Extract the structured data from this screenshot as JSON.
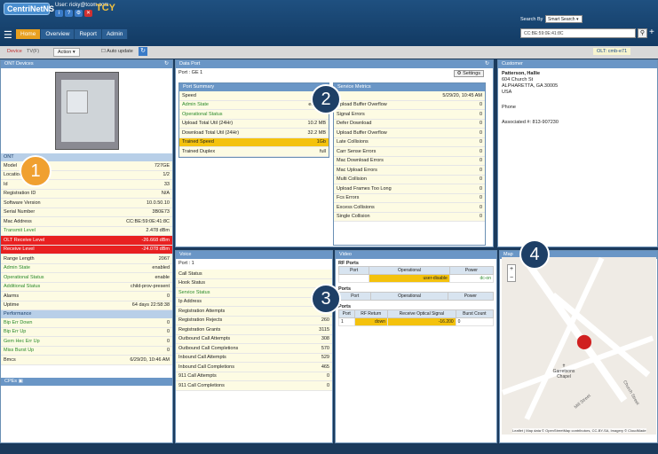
{
  "header": {
    "logo": "CentriNetNS",
    "user": "User: ricky@tcom.com",
    "brand_y": "TCY",
    "nav": [
      "Home",
      "Overview",
      "Report",
      "Admin"
    ],
    "search_label": "Search By",
    "search_mode": "Smart Search",
    "search_value": "CC:BE:59:0E:41:8C"
  },
  "subbar": {
    "device": "Device",
    "tbd": "TV(F)",
    "action": "Action",
    "auto_update": "Auto update",
    "olt": "OLT: cmb-e71"
  },
  "ont": {
    "title": "ONT Devices",
    "section": "ONT",
    "rows": [
      {
        "k": "Model",
        "v": "727GE",
        "g": false
      },
      {
        "k": "Location",
        "v": "1/2",
        "g": false
      },
      {
        "k": "Id",
        "v": "33",
        "g": false
      },
      {
        "k": "Registration ID",
        "v": "N/A",
        "g": false
      },
      {
        "k": "Software Version",
        "v": "10.0.50.10",
        "g": false
      },
      {
        "k": "Serial Number",
        "v": "3B0E73",
        "g": false
      },
      {
        "k": "Mac Address",
        "v": "CC:BE:59:0E:41:8C",
        "g": false
      },
      {
        "k": "Transmit Level",
        "v": "2.478 dBm",
        "g": true
      }
    ],
    "red_rows": [
      {
        "k": "OLT Receive Level",
        "v": "-26.668 dBm"
      },
      {
        "k": "Receive Level",
        "v": "-24.078 dBm"
      }
    ],
    "rows2": [
      {
        "k": "Range Length",
        "v": "2067",
        "g": false
      },
      {
        "k": "Admin State",
        "v": "enabled",
        "g": true
      },
      {
        "k": "Operational Status",
        "v": "enable",
        "g": true
      },
      {
        "k": "Additional Status",
        "v": "child-prov-present",
        "g": true
      },
      {
        "k": "Alarms",
        "v": "0",
        "g": false
      },
      {
        "k": "Uptime",
        "v": "64 days 22:58:38",
        "g": false
      }
    ],
    "perf_title": "Performance",
    "perf": [
      {
        "k": "Bip Err Down",
        "v": "0",
        "g": true
      },
      {
        "k": "Bip Err Up",
        "v": "0",
        "g": true
      },
      {
        "k": "Gem Hec Err Up",
        "v": "0",
        "g": true
      },
      {
        "k": "Miss Burst Up",
        "v": "0",
        "g": true
      },
      {
        "k": "Bmcs",
        "v": "6/29/20, 10:46 AM",
        "g": false
      }
    ],
    "cpe": "CPEs"
  },
  "dataport": {
    "title": "Data Port",
    "port": "Port : GE 1",
    "settings": "Settings",
    "summary_title": "Port Summary",
    "summary": [
      {
        "k": "Speed",
        "v": "",
        "cls": ""
      },
      {
        "k": "Admin State",
        "v": "enabled",
        "cls": "g"
      },
      {
        "k": "Operational Status",
        "v": "",
        "cls": "g"
      },
      {
        "k": "Upload Total Util (24Hr)",
        "v": "10.2 MB",
        "cls": ""
      },
      {
        "k": "Download Total Util (24Hr)",
        "v": "32.2 MB",
        "cls": ""
      },
      {
        "k": "Trained Speed",
        "v": "1Gb",
        "cls": "yellow"
      },
      {
        "k": "Trained Duplex",
        "v": "full",
        "cls": ""
      }
    ],
    "metrics_title": "Service Metrics",
    "metrics": [
      {
        "k": "",
        "v": "5/29/20, 10:45 AM"
      },
      {
        "k": "Upload Buffer Overflow",
        "v": "0"
      },
      {
        "k": "Signal Errors",
        "v": "0"
      },
      {
        "k": "Defer Download",
        "v": "0"
      },
      {
        "k": "Upload Buffer Overflow",
        "v": "0"
      },
      {
        "k": "Late Collisions",
        "v": "0"
      },
      {
        "k": "Carr Sense Errors",
        "v": "0"
      },
      {
        "k": "Mac Download Errors",
        "v": "0"
      },
      {
        "k": "Mac Upload Errors",
        "v": "0"
      },
      {
        "k": "Multi Collision",
        "v": "0"
      },
      {
        "k": "Upload Frames Too Long",
        "v": "0"
      },
      {
        "k": "Fcs Errors",
        "v": "0"
      },
      {
        "k": "Excess Collisions",
        "v": "0"
      },
      {
        "k": "Single Collision",
        "v": "0"
      }
    ]
  },
  "customer": {
    "title": "Customer",
    "name": "Patterson, Hallie",
    "addr1": "604 Church St",
    "addr2": "ALPHARETTA, GA 30005",
    "addr3": "USA",
    "phone": "Phone",
    "assoc": "Associated #: 813-907230"
  },
  "voice": {
    "title": "Voice",
    "port": "Port : 1",
    "rows": [
      {
        "k": "Call Status",
        "v": "",
        "g": false
      },
      {
        "k": "Hook Status",
        "v": "",
        "g": false
      },
      {
        "k": "Service Status",
        "v": "",
        "g": true
      },
      {
        "k": "Ip Address",
        "v": "199.1",
        "g": false
      },
      {
        "k": "Registration Attempts",
        "v": "",
        "g": false
      },
      {
        "k": "Registration Rejects",
        "v": "260",
        "g": false
      },
      {
        "k": "Registration Grants",
        "v": "3115",
        "g": false
      },
      {
        "k": "Outbound Call Attempts",
        "v": "308",
        "g": false
      },
      {
        "k": "Outbound Call Completions",
        "v": "570",
        "g": false
      },
      {
        "k": "Inbound Call Attempts",
        "v": "529",
        "g": false
      },
      {
        "k": "Inbound Call Completions",
        "v": "465",
        "g": false
      },
      {
        "k": "911 Call Attempts",
        "v": "0",
        "g": false
      },
      {
        "k": "911 Call Completions",
        "v": "0",
        "g": false
      }
    ]
  },
  "video": {
    "title": "Video",
    "rf_title": "RF Ports",
    "rf_cols": [
      "Port",
      "Operational",
      "Power"
    ],
    "rf_row": [
      "",
      "user-disable",
      "dc-on"
    ],
    "ports_title": "Ports",
    "ports_cols": [
      "Port",
      "Operational",
      "Power"
    ],
    "opt_title": "Ports",
    "opt_cols": [
      "Port",
      "RF Return",
      "Receive Optical Signal",
      "Burst Count"
    ],
    "opt_row": [
      "1",
      "down",
      "-16.200",
      "0"
    ]
  },
  "map": {
    "title": "Map",
    "label1": "Garretsons Chapel",
    "road": "Mill Street",
    "road2": "Church Street",
    "attrib": "Leaflet | Map data © OpenStreetMap contributors, CC-BY-SA, Imagery © CloudMade"
  },
  "badges": [
    "1",
    "2",
    "3",
    "4"
  ]
}
